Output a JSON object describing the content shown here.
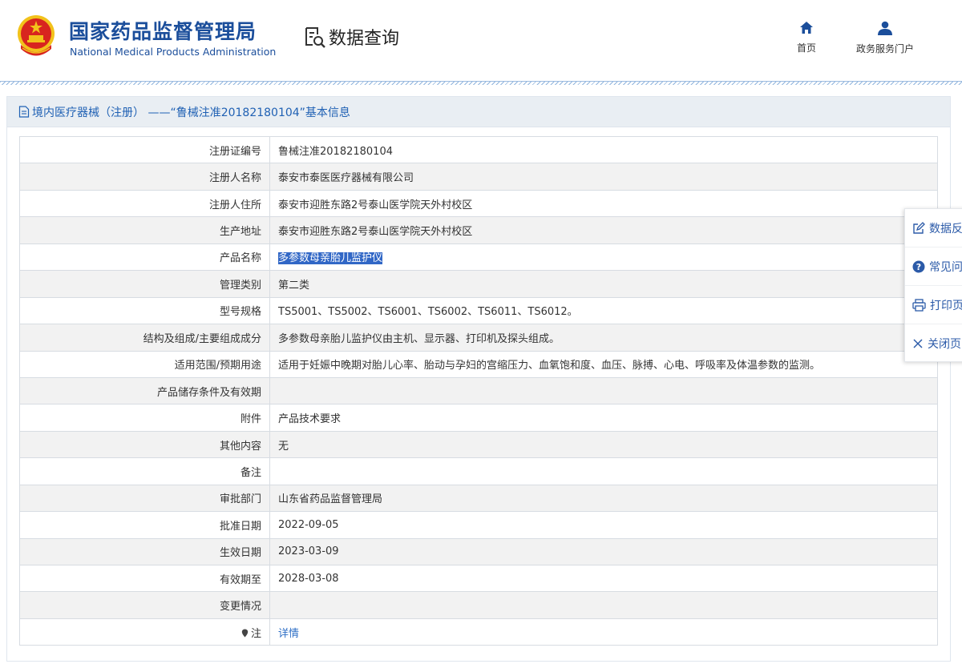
{
  "header": {
    "org_name_cn": "国家药品监督管理局",
    "org_name_en": "National Medical Products Administration",
    "query_title": "数据查询",
    "nav": {
      "home_label": "首页",
      "portal_label": "政务服务门户"
    }
  },
  "panel": {
    "title": "境内医疗器械（注册） ——“鲁械注准20182180104”基本信息",
    "rows": [
      {
        "label": "注册证编号",
        "value": "鲁械注准20182180104"
      },
      {
        "label": "注册人名称",
        "value": "泰安市泰医医疗器械有限公司"
      },
      {
        "label": "注册人住所",
        "value": "泰安市迎胜东路2号泰山医学院天外村校区"
      },
      {
        "label": "生产地址",
        "value": "泰安市迎胜东路2号泰山医学院天外村校区"
      },
      {
        "label": "产品名称",
        "value": "多参数母亲胎儿监护仪"
      },
      {
        "label": "管理类别",
        "value": "第二类"
      },
      {
        "label": "型号规格",
        "value": "TS5001、TS5002、TS6001、TS6002、TS6011、TS6012。"
      },
      {
        "label": "结构及组成/主要组成成分",
        "value": "多参数母亲胎儿监护仪由主机、显示器、打印机及探头组成。"
      },
      {
        "label": "适用范围/预期用途",
        "value": "适用于妊娠中晚期对胎儿心率、胎动与孕妇的宫缩压力、血氧饱和度、血压、脉搏、心电、呼吸率及体温参数的监测。"
      },
      {
        "label": "产品储存条件及有效期",
        "value": ""
      },
      {
        "label": "附件",
        "value": "产品技术要求"
      },
      {
        "label": "其他内容",
        "value": "无"
      },
      {
        "label": "备注",
        "value": ""
      },
      {
        "label": "审批部门",
        "value": "山东省药品监督管理局"
      },
      {
        "label": "批准日期",
        "value": "2022-09-05"
      },
      {
        "label": "生效日期",
        "value": "2023-03-09"
      },
      {
        "label": "有效期至",
        "value": "2028-03-08"
      },
      {
        "label": "变更情况",
        "value": ""
      },
      {
        "label": "注",
        "value": "详情"
      }
    ]
  },
  "side_tools": {
    "feedback": "数据反",
    "faq": "常见问",
    "print": "打印页",
    "close": "关闭页"
  },
  "colors": {
    "brand_blue": "#1b4e9b",
    "link_blue": "#2f6fc6",
    "emblem_red": "#d8251f",
    "emblem_gold": "#f2c21b"
  }
}
